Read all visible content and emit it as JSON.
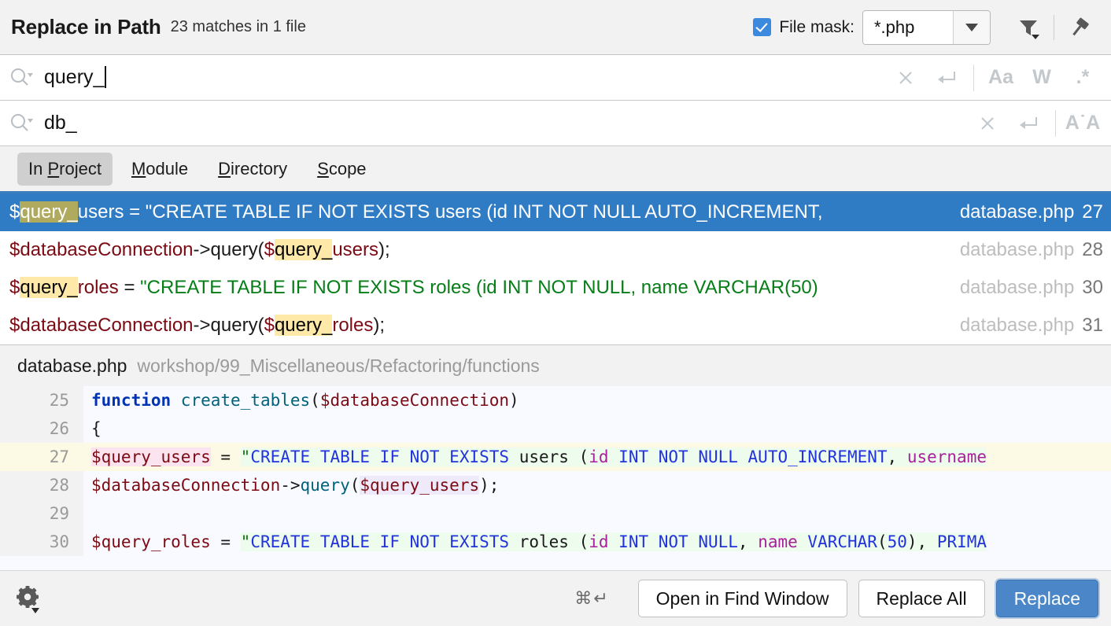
{
  "titlebar": {
    "title": "Replace in Path",
    "subtitle": "23 matches in 1 file",
    "file_mask_label": "File mask:",
    "file_mask_value": "*.php",
    "file_mask_checked": true,
    "filter_icon": "filter-funnel-icon",
    "pin_icon": "pin-icon",
    "accent_color": "#3c8ade"
  },
  "search": {
    "icon": "search-icon",
    "value": "query_",
    "clear_icon": "close-icon",
    "history_icon": "return-arrow-icon",
    "match_case_label": "Aa",
    "words_label": "W",
    "regex_label": ".*"
  },
  "replace": {
    "icon": "search-icon",
    "value": "db_",
    "clear_icon": "close-icon",
    "history_icon": "return-arrow-icon",
    "preserve_case_label": "A˙A"
  },
  "scope": {
    "tabs": [
      {
        "label": "In Project",
        "pre": "In ",
        "mnemonic": "P",
        "post": "roject",
        "active": true
      },
      {
        "label": "Module",
        "pre": "",
        "mnemonic": "M",
        "post": "odule",
        "active": false
      },
      {
        "label": "Directory",
        "pre": "",
        "mnemonic": "D",
        "post": "irectory",
        "active": false
      },
      {
        "label": "Scope",
        "pre": "",
        "mnemonic": "S",
        "post": "cope",
        "active": false
      }
    ]
  },
  "results": [
    {
      "selected": true,
      "file": "database.php",
      "line": "27",
      "segments": [
        {
          "t": "$",
          "c": "var"
        },
        {
          "t": "query_",
          "c": "hl"
        },
        {
          "t": "users",
          "c": "var"
        },
        {
          "t": " = ",
          "c": "plain"
        },
        {
          "t": "\"CREATE TABLE IF NOT EXISTS users (id INT NOT NULL AUTO_INCREMENT,",
          "c": "str"
        }
      ]
    },
    {
      "selected": false,
      "file": "database.php",
      "line": "28",
      "segments": [
        {
          "t": "$",
          "c": "var"
        },
        {
          "t": "databaseConnection",
          "c": "var"
        },
        {
          "t": "->",
          "c": "plain"
        },
        {
          "t": "query(",
          "c": "plain"
        },
        {
          "t": "$",
          "c": "var"
        },
        {
          "t": "query_",
          "c": "hl"
        },
        {
          "t": "users",
          "c": "var"
        },
        {
          "t": ");",
          "c": "plain"
        }
      ]
    },
    {
      "selected": false,
      "file": "database.php",
      "line": "30",
      "segments": [
        {
          "t": "$",
          "c": "var"
        },
        {
          "t": "query_",
          "c": "hl"
        },
        {
          "t": "roles",
          "c": "var"
        },
        {
          "t": " = ",
          "c": "plain"
        },
        {
          "t": "\"CREATE TABLE IF NOT EXISTS roles (id INT NOT NULL, name VARCHAR(50)",
          "c": "str"
        }
      ]
    },
    {
      "selected": false,
      "file": "database.php",
      "line": "31",
      "segments": [
        {
          "t": "$",
          "c": "var"
        },
        {
          "t": "databaseConnection",
          "c": "var"
        },
        {
          "t": "->",
          "c": "plain"
        },
        {
          "t": "query(",
          "c": "plain"
        },
        {
          "t": "$",
          "c": "var"
        },
        {
          "t": "query_",
          "c": "hl"
        },
        {
          "t": "roles",
          "c": "var"
        },
        {
          "t": ");",
          "c": "plain"
        }
      ]
    }
  ],
  "preview": {
    "file": "database.php",
    "path": "workshop/99_Miscellaneous/Refactoring/functions",
    "lines": [
      {
        "num": "25",
        "highlight": false,
        "tokens": [
          {
            "t": "function ",
            "c": "kw"
          },
          {
            "t": "create_tables",
            "c": "fn"
          },
          {
            "t": "(",
            "c": "punct"
          },
          {
            "t": "$databaseConnection",
            "c": "var"
          },
          {
            "t": ")",
            "c": "punct"
          }
        ]
      },
      {
        "num": "26",
        "highlight": false,
        "tokens": [
          {
            "t": "{",
            "c": "punct"
          }
        ]
      },
      {
        "num": "27",
        "highlight": true,
        "tokens": [
          {
            "t": "    ",
            "c": "txt"
          },
          {
            "t": "$query_users",
            "c": "var pinkhl"
          },
          {
            "t": " = ",
            "c": "op"
          },
          {
            "t": "\"",
            "c": "str strbg"
          },
          {
            "t": "CREATE TABLE IF NOT EXISTS",
            "c": "sql strbg"
          },
          {
            "t": " users ",
            "c": "txt strbg"
          },
          {
            "t": "(",
            "c": "txt strbg"
          },
          {
            "t": "id",
            "c": "ident strbg"
          },
          {
            "t": " ",
            "c": "txt strbg"
          },
          {
            "t": "INT NOT NULL AUTO_INCREMENT",
            "c": "sql strbg"
          },
          {
            "t": ", ",
            "c": "txt strbg"
          },
          {
            "t": "username",
            "c": "ident strbg"
          }
        ]
      },
      {
        "num": "28",
        "highlight": false,
        "tokens": [
          {
            "t": "    ",
            "c": "txt"
          },
          {
            "t": "$databaseConnection",
            "c": "var"
          },
          {
            "t": "->",
            "c": "op"
          },
          {
            "t": "query",
            "c": "fn"
          },
          {
            "t": "(",
            "c": "punct"
          },
          {
            "t": "$query_users",
            "c": "var lavhl"
          },
          {
            "t": ");",
            "c": "punct"
          }
        ]
      },
      {
        "num": "29",
        "highlight": false,
        "tokens": []
      },
      {
        "num": "30",
        "highlight": false,
        "tokens": [
          {
            "t": "    ",
            "c": "txt"
          },
          {
            "t": "$query_roles",
            "c": "var"
          },
          {
            "t": " = ",
            "c": "op"
          },
          {
            "t": "\"",
            "c": "str strbg"
          },
          {
            "t": "CREATE TABLE IF NOT EXISTS",
            "c": "sql strbg"
          },
          {
            "t": " roles ",
            "c": "txt strbg"
          },
          {
            "t": "(",
            "c": "txt strbg"
          },
          {
            "t": "id",
            "c": "ident strbg"
          },
          {
            "t": " ",
            "c": "txt strbg"
          },
          {
            "t": "INT NOT NULL",
            "c": "sql strbg"
          },
          {
            "t": ", ",
            "c": "txt strbg"
          },
          {
            "t": "name",
            "c": "ident strbg"
          },
          {
            "t": " ",
            "c": "txt strbg"
          },
          {
            "t": "VARCHAR",
            "c": "sql strbg"
          },
          {
            "t": "(",
            "c": "txt strbg"
          },
          {
            "t": "50",
            "c": "num strbg"
          },
          {
            "t": "), ",
            "c": "txt strbg"
          },
          {
            "t": "PRIMA",
            "c": "sql strbg"
          }
        ]
      }
    ]
  },
  "footer": {
    "settings_icon": "gear-icon",
    "shortcut": "⌘↵",
    "open_in_find_window_label": "Open in Find Window",
    "replace_all_label": "Replace All",
    "replace_label": "Replace",
    "primary_color": "#4a86c8"
  }
}
